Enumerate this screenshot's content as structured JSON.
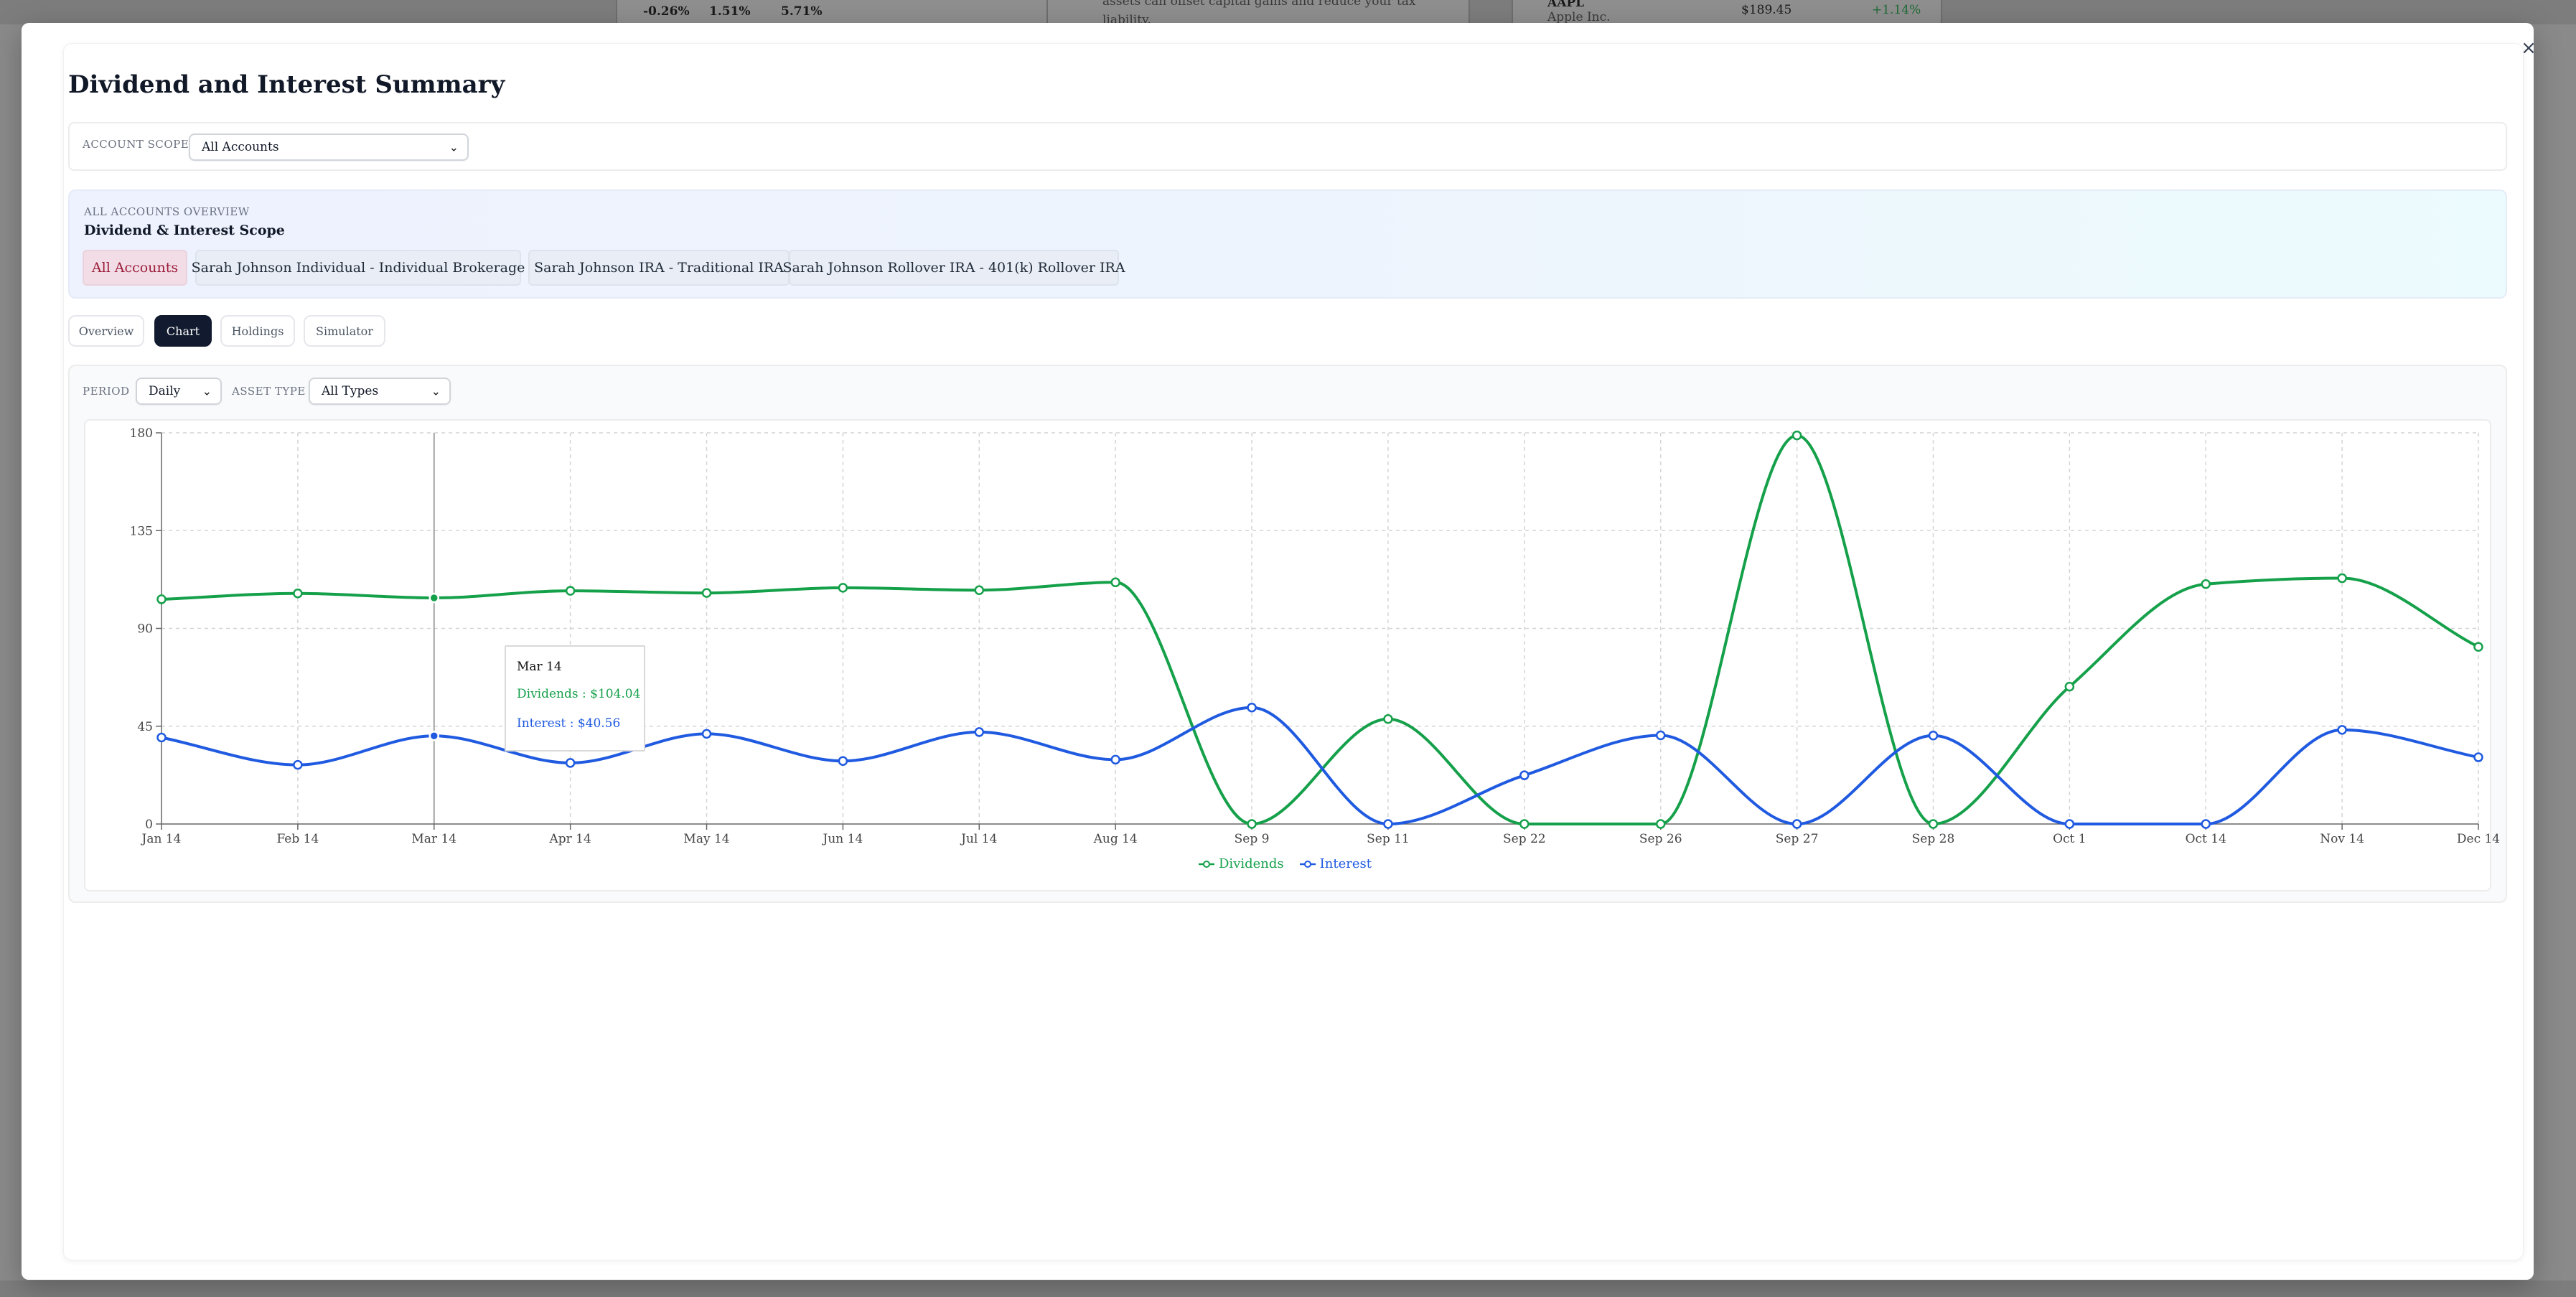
{
  "background": {
    "perf_values": [
      "-0.26%",
      "1.51%",
      "5.71%"
    ],
    "note_text": "assets can offset capital gains and reduce your tax",
    "note_text_2": "liability.",
    "ticker": "AAPL",
    "company": "Apple Inc.",
    "price": "$189.45",
    "change": "+1.14%"
  },
  "modal": {
    "title": "Dividend and Interest Summary",
    "close_glyph": "×",
    "account_scope_label": "ACCOUNT SCOPE",
    "account_scope_value": "All Accounts",
    "overview": {
      "caption": "ALL ACCOUNTS OVERVIEW",
      "heading": "Dividend & Interest Scope",
      "chips": [
        "All Accounts",
        "Sarah Johnson Individual - Individual Brokerage",
        "Sarah Johnson IRA - Traditional IRA",
        "Sarah Johnson Rollover IRA - 401(k) Rollover IRA"
      ],
      "active_chip": 0
    },
    "tabs": [
      "Overview",
      "Chart",
      "Holdings",
      "Simulator"
    ],
    "active_tab": 1,
    "filters": {
      "period_label": "PERIOD",
      "period_value": "Daily",
      "asset_type_label": "ASSET TYPE",
      "asset_type_value": "All Types"
    },
    "tooltip": {
      "title": "Mar 14",
      "dividends_text": "Dividends : $104.04",
      "interest_text": "Interest : $40.56"
    }
  },
  "colors": {
    "dividends": "#15a04a",
    "interest": "#1f5ae0",
    "active_tab": "#111a2e",
    "active_chip_text": "#9b1c3a"
  },
  "chart_data": {
    "type": "line",
    "x": [
      "Jan 14",
      "Feb 14",
      "Mar 14",
      "Apr 14",
      "May 14",
      "Jun 14",
      "Jul 14",
      "Aug 14",
      "Sep 9",
      "Sep 11",
      "Sep 22",
      "Sep 26",
      "Sep 27",
      "Sep 28",
      "Oct 1",
      "Oct 14",
      "Nov 14",
      "Dec 14"
    ],
    "series": [
      {
        "name": "Dividends",
        "values": [
          103.4,
          106.1,
          104.04,
          107.3,
          106.3,
          108.7,
          107.6,
          111.2,
          0,
          48.3,
          0,
          0,
          178.8,
          0,
          63.2,
          110.4,
          113.1,
          81.5
        ]
      },
      {
        "name": "Interest",
        "values": [
          39.8,
          27.2,
          40.56,
          28.1,
          41.5,
          29.0,
          42.3,
          29.6,
          53.6,
          0,
          22.4,
          40.8,
          0,
          40.7,
          0,
          0,
          43.3,
          30.7
        ]
      }
    ],
    "yticks": [
      0,
      45,
      90,
      135,
      180
    ],
    "ylim": [
      0,
      180
    ],
    "grid": true,
    "legend": "bottom-center",
    "hover_index": 2
  }
}
